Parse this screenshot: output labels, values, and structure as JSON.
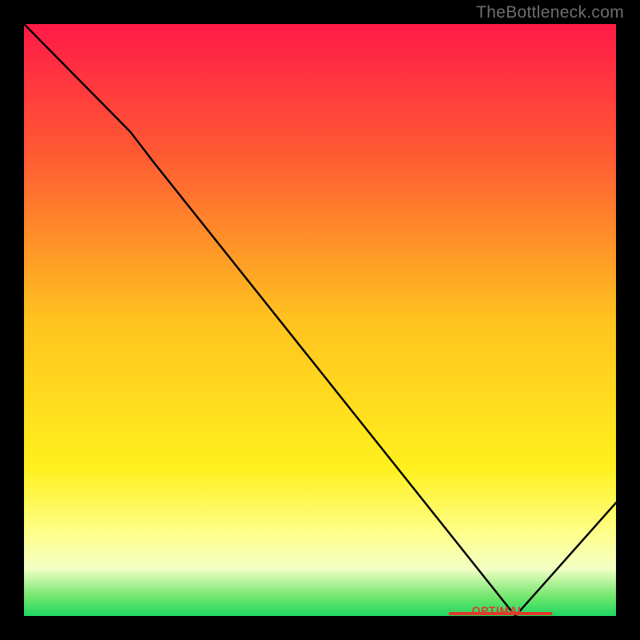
{
  "watermark": "TheBottleneck.com",
  "optimal_label": "OPTIMAL",
  "chart_data": {
    "type": "line",
    "title": "",
    "xlabel": "",
    "ylabel": "",
    "x": [
      0,
      18,
      22,
      83,
      100
    ],
    "values": [
      115,
      94,
      88,
      0,
      22
    ],
    "ylim": [
      0,
      115
    ],
    "xlim": [
      0,
      100
    ],
    "gradient_stops": [
      {
        "pct": 0,
        "color": "#ff1a47"
      },
      {
        "pct": 22,
        "color": "#ff5a33"
      },
      {
        "pct": 50,
        "color": "#ffc31f"
      },
      {
        "pct": 75,
        "color": "#fff01e"
      },
      {
        "pct": 86,
        "color": "#feff8a"
      },
      {
        "pct": 92,
        "color": "#f3ffc4"
      },
      {
        "pct": 97,
        "color": "#6be469"
      },
      {
        "pct": 100,
        "color": "#1fd865"
      }
    ],
    "optimal_marker": {
      "x_start": 72,
      "x_end": 89,
      "y": 0
    }
  }
}
